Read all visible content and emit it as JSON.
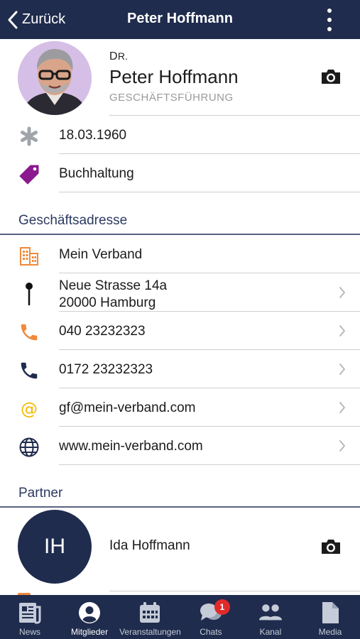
{
  "header": {
    "back_label": "Zurück",
    "title": "Peter Hoffmann",
    "menu_icon": "more-vertical-icon"
  },
  "profile": {
    "prefix_first": "D",
    "prefix_rest": "R.",
    "name": "Peter Hoffmann",
    "position": "GESCHÄFTSFÜHRUNG",
    "camera_icon": "camera-icon"
  },
  "personal": [
    {
      "icon": "asterisk-icon",
      "text": "18.03.1960",
      "color": "#a0a4ab"
    },
    {
      "icon": "tag-icon",
      "text": "Buchhaltung",
      "color": "#8b1a8e"
    }
  ],
  "business": {
    "section_label": "Geschäftsadresse",
    "organisation": {
      "icon": "building-icon",
      "text": "Mein Verband",
      "color": "#f0893a"
    },
    "address": {
      "icon": "map-pin-icon",
      "line1": "Neue Strasse 14a",
      "line2": "20000 Hamburg"
    },
    "phone": {
      "icon": "phone-icon",
      "text": "040 23232323",
      "color": "#f0893a"
    },
    "mobile": {
      "icon": "phone-icon",
      "text": "0172 23232323",
      "color": "#1f2c4d"
    },
    "email": {
      "icon": "at-icon",
      "text": "gf@mein-verband.com",
      "color": "#f5b800"
    },
    "website": {
      "icon": "globe-icon",
      "text": "www.mein-verband.com",
      "color": "#1f2c4d"
    }
  },
  "partner": {
    "section_label": "Partner",
    "initials": "IH",
    "name": "Ida Hoffmann"
  },
  "tabs": [
    {
      "label": "News",
      "icon": "newspaper-icon",
      "active": false
    },
    {
      "label": "Mitglieder",
      "icon": "user-circle-icon",
      "active": true
    },
    {
      "label": "Veranstaltungen",
      "icon": "calendar-icon",
      "active": false
    },
    {
      "label": "Chats",
      "icon": "chat-bubbles-icon",
      "badge": "1",
      "active": false
    },
    {
      "label": "Kanal",
      "icon": "users-icon",
      "active": false
    },
    {
      "label": "Media",
      "icon": "document-icon",
      "active": false
    }
  ],
  "colors": {
    "brand_navy": "#1f2c4d",
    "accent_orange": "#f0893a",
    "badge_red": "#e02a2a"
  }
}
